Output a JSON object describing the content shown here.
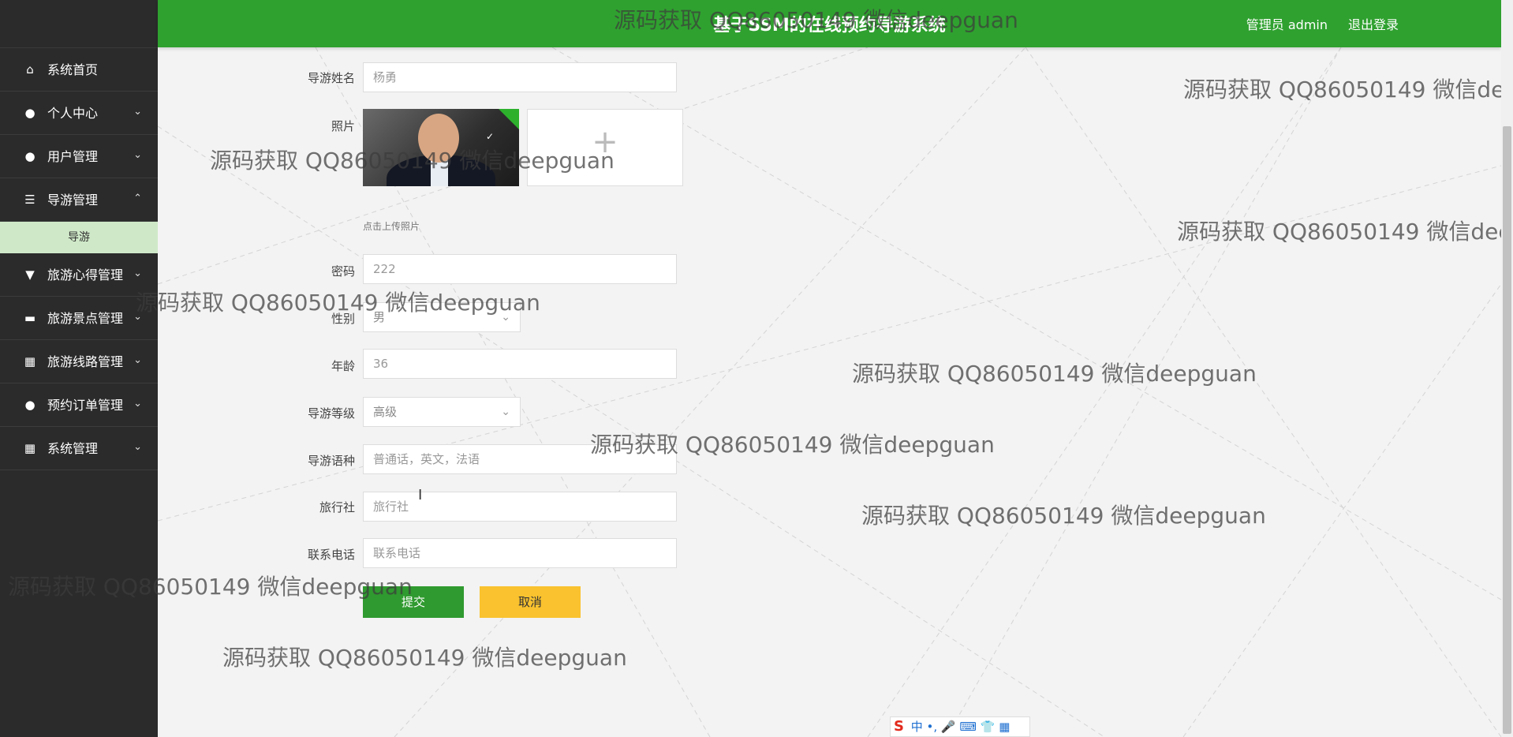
{
  "header": {
    "title": "基于SSM的在线预约导游系统",
    "user": "管理员 admin",
    "logout": "退出登录"
  },
  "sidebar": {
    "items": [
      {
        "label": "系统首页",
        "icon": "home-icon"
      },
      {
        "label": "个人中心",
        "icon": "user-icon"
      },
      {
        "label": "用户管理",
        "icon": "user-icon"
      },
      {
        "label": "导游管理",
        "icon": "sliders-icon"
      },
      {
        "label": "旅游心得管理",
        "icon": "pin-icon"
      },
      {
        "label": "旅游景点管理",
        "icon": "ticket-icon"
      },
      {
        "label": "旅游线路管理",
        "icon": "grid-icon"
      },
      {
        "label": "预约订单管理",
        "icon": "bulb-icon"
      },
      {
        "label": "系统管理",
        "icon": "grid-icon"
      }
    ],
    "submenu": "导游"
  },
  "form": {
    "name_label": "导游姓名",
    "name_value": "杨勇",
    "photo_label": "照片",
    "photo_hint": "点击上传照片",
    "password_label": "密码",
    "password_value": "222",
    "gender_label": "性别",
    "gender_value": "男",
    "age_label": "年龄",
    "age_value": "36",
    "level_label": "导游等级",
    "level_value": "高级",
    "language_label": "导游语种",
    "language_placeholder": "普通话，英文，法语",
    "agency_label": "旅行社",
    "agency_placeholder": "旅行社",
    "phone_label": "联系电话",
    "phone_placeholder": "联系电话",
    "submit": "提交",
    "cancel": "取消"
  },
  "watermark": "源码获取 QQ86050149 微信deepguan",
  "ime": {
    "logo": "S",
    "text": "中 •, 🎤 ⌨ 👕 ▦"
  }
}
